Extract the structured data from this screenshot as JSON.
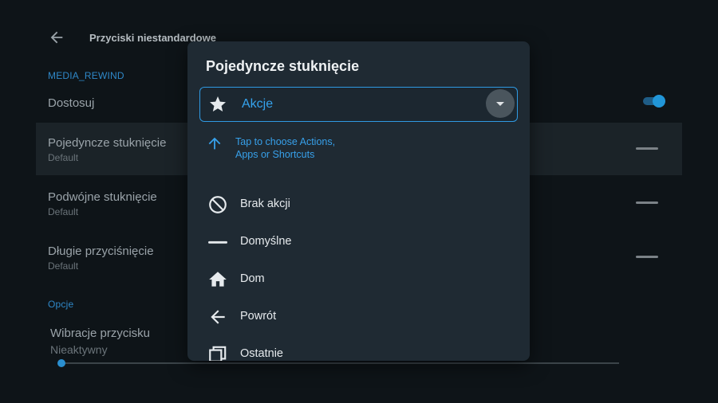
{
  "background": {
    "header_title": "Przyciski niestandardowe",
    "section_key": "MEDIA_REWIND",
    "customize_label": "Dostosuj",
    "rows": [
      {
        "title": "Pojedyncze stuknięcie",
        "subtitle": "Default"
      },
      {
        "title": "Podwójne stuknięcie",
        "subtitle": "Default"
      },
      {
        "title": "Długie przyciśnięcie",
        "subtitle": "Default"
      }
    ],
    "options_section": "Opcje",
    "vibration": {
      "title": "Wibracje przycisku",
      "subtitle": "Nieaktywny"
    },
    "toggle_on": true,
    "accent_color": "#2196d8"
  },
  "dialog": {
    "title": "Pojedyncze stuknięcie",
    "dropdown": {
      "icon": "star-icon",
      "value": "Akcje"
    },
    "hint": "Tap to choose Actions, Apps or Shortcuts",
    "options": [
      {
        "icon": "block-icon",
        "label": "Brak akcji"
      },
      {
        "icon": "dash-icon",
        "label": "Domyślne"
      },
      {
        "icon": "home-icon",
        "label": "Dom"
      },
      {
        "icon": "arrow-left-icon",
        "label": "Powrót"
      },
      {
        "icon": "recents-icon",
        "label": "Ostatnie"
      }
    ],
    "accent_color": "#35a3ee"
  }
}
